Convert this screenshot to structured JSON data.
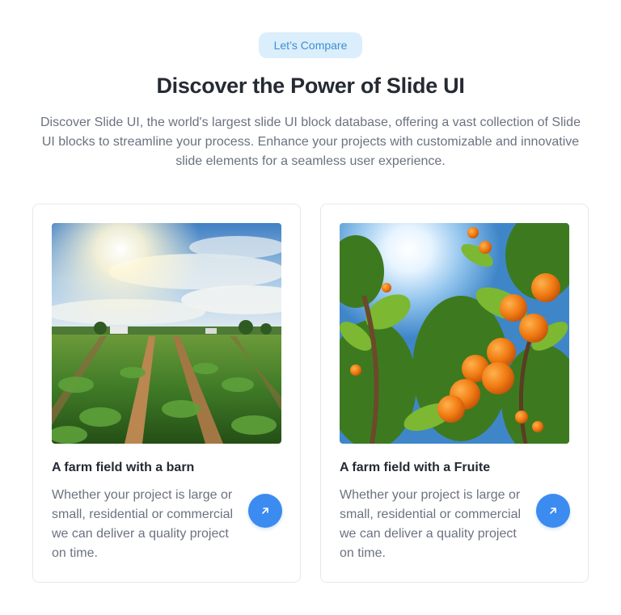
{
  "badge": "Let’s Compare",
  "title": "Discover the Power of Slide UI",
  "description": "Discover Slide UI, the world's largest slide UI block database, offering a vast collection of Slide UI blocks to streamline your process. Enhance your projects with customizable and innovative slide elements for a seamless user experience.",
  "cards": [
    {
      "title": "A farm field with a barn",
      "text": "Whether your project is large or small, residential or commercial we can deliver a quality project on time.",
      "image": "farm-field-barn-image",
      "action_icon": "arrow-up-right-icon"
    },
    {
      "title": "A farm field with a Fruite",
      "text": "Whether your project is large or small, residential or commercial we can deliver a quality project on time.",
      "image": "orange-tree-image",
      "action_icon": "arrow-up-right-icon"
    }
  ],
  "colors": {
    "badge_bg": "#dbeefb",
    "badge_text": "#3b8fd4",
    "accent": "#3b8bf0",
    "heading": "#252a33",
    "body_text": "#6b7280",
    "card_border": "#e5e7eb"
  }
}
